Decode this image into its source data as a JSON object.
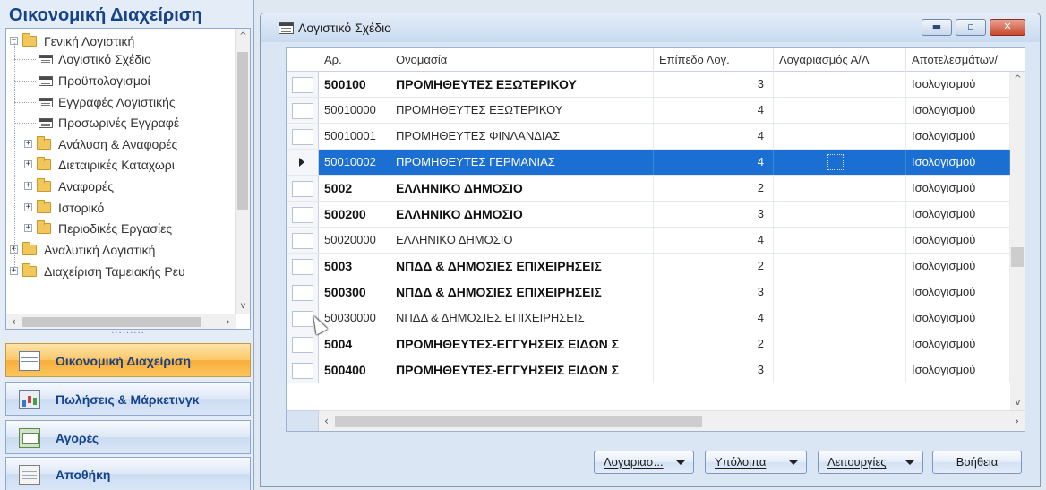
{
  "nav": {
    "title": "Οικονομική Διαχείριση",
    "tree": [
      {
        "label": "Γενική Λογιστική",
        "type": "folder",
        "expanded": true
      },
      {
        "label": "Λογιστικό Σχέδιο",
        "type": "form"
      },
      {
        "label": "Προϋπολογισμοί",
        "type": "form"
      },
      {
        "label": "Εγγραφές Λογιστικής",
        "type": "form"
      },
      {
        "label": "Προσωρινές Εγγραφέ",
        "type": "form"
      },
      {
        "label": "Ανάλυση & Αναφορές",
        "type": "folder",
        "expanded": false
      },
      {
        "label": "Διεταιρικές Καταχωρι",
        "type": "folder",
        "expanded": false
      },
      {
        "label": "Αναφορές",
        "type": "folder",
        "expanded": false
      },
      {
        "label": "Ιστορικό",
        "type": "folder",
        "expanded": false
      },
      {
        "label": "Περιοδικές Εργασίες",
        "type": "folder",
        "expanded": false
      },
      {
        "label": "Αναλυτική Λογιστική",
        "type": "folder",
        "expanded": false
      },
      {
        "label": "Διαχείριση Ταμειακής Ρευ",
        "type": "folder",
        "expanded": false
      }
    ],
    "grip": "·········",
    "buttons": [
      {
        "label": "Οικονομική Διαχείριση",
        "icon": "ledger-icon",
        "active": true
      },
      {
        "label": "Πωλήσεις & Μάρκετινγκ",
        "icon": "sales-chart-icon",
        "active": false
      },
      {
        "label": "Αγορές",
        "icon": "purchase-icon",
        "active": false
      },
      {
        "label": "Αποθήκη",
        "icon": "warehouse-icon",
        "active": false
      }
    ]
  },
  "window": {
    "title": "Λογιστικό Σχέδιο",
    "controls": {
      "minimize": "▬",
      "restore": "▫",
      "close": "✕"
    }
  },
  "grid": {
    "columns": [
      "Αρ.",
      "Ονομασία",
      "Επίπεδο Λογ.",
      "Λογαριασμός Α/Λ",
      "Αποτελεσμάτων/"
    ],
    "rows": [
      {
        "no": "500100",
        "name": "ΠΡΟΜΗΘΕΥΤΕΣ ΕΞΩΤΕΡΙΚΟΥ",
        "level": "3",
        "account": "",
        "type": "Ισολογισμού",
        "bold": true,
        "selected": false
      },
      {
        "no": "50010000",
        "name": "ΠΡΟΜΗΘΕΥΤΕΣ ΕΞΩΤΕΡΙΚΟΥ",
        "level": "4",
        "account": "",
        "type": "Ισολογισμού",
        "bold": false,
        "selected": false
      },
      {
        "no": "50010001",
        "name": "ΠΡΟΜΗΘΕΥΤΕΣ ΦΙΝΛΑΝΔΙΑΣ",
        "level": "4",
        "account": "",
        "type": "Ισολογισμού",
        "bold": false,
        "selected": false
      },
      {
        "no": "50010002",
        "name": "ΠΡΟΜΗΘΕΥΤΕΣ ΓΕΡΜΑΝΙΑΣ",
        "level": "4",
        "account": "",
        "type": "Ισολογισμού",
        "bold": false,
        "selected": true
      },
      {
        "no": "5002",
        "name": "ΕΛΛΗΝΙΚΟ ΔΗΜΟΣΙΟ",
        "level": "2",
        "account": "",
        "type": "Ισολογισμού",
        "bold": true,
        "selected": false
      },
      {
        "no": "500200",
        "name": "ΕΛΛΗΝΙΚΟ ΔΗΜΟΣΙΟ",
        "level": "3",
        "account": "",
        "type": "Ισολογισμού",
        "bold": true,
        "selected": false
      },
      {
        "no": "50020000",
        "name": "ΕΛΛΗΝΙΚΟ ΔΗΜΟΣΙΟ",
        "level": "4",
        "account": "",
        "type": "Ισολογισμού",
        "bold": false,
        "selected": false
      },
      {
        "no": "5003",
        "name": "ΝΠΔΔ & ΔΗΜΟΣΙΕΣ ΕΠΙΧΕΙΡΗΣΕΙΣ",
        "level": "2",
        "account": "",
        "type": "Ισολογισμού",
        "bold": true,
        "selected": false
      },
      {
        "no": "500300",
        "name": "ΝΠΔΔ & ΔΗΜΟΣΙΕΣ ΕΠΙΧΕΙΡΗΣΕΙΣ",
        "level": "3",
        "account": "",
        "type": "Ισολογισμού",
        "bold": true,
        "selected": false
      },
      {
        "no": "50030000",
        "name": "ΝΠΔΔ & ΔΗΜΟΣΙΕΣ ΕΠΙΧΕΙΡΗΣΕΙΣ",
        "level": "4",
        "account": "",
        "type": "Ισολογισμού",
        "bold": false,
        "selected": false
      },
      {
        "no": "5004",
        "name": "ΠΡΟΜΗΘΕΥΤΕΣ-ΕΓΓΥΗΣΕΙΣ ΕΙΔΩΝ Σ",
        "level": "2",
        "account": "",
        "type": "Ισολογισμού",
        "bold": true,
        "selected": false
      },
      {
        "no": "500400",
        "name": "ΠΡΟΜΗΘΕΥΤΕΣ-ΕΓΓΥΗΣΕΙΣ ΕΙΔΩΝ Σ",
        "level": "3",
        "account": "",
        "type": "Ισολογισμού",
        "bold": true,
        "selected": false
      }
    ]
  },
  "buttons": {
    "account": "Λογαριασ...",
    "balances": "Υπόλοιπα",
    "functions": "Λειτουργίες",
    "help": "Βοήθεια"
  },
  "colors": {
    "selection": "#1b6fd3",
    "nav_active": "#f9ad3a",
    "title_blue": "#15428b"
  }
}
